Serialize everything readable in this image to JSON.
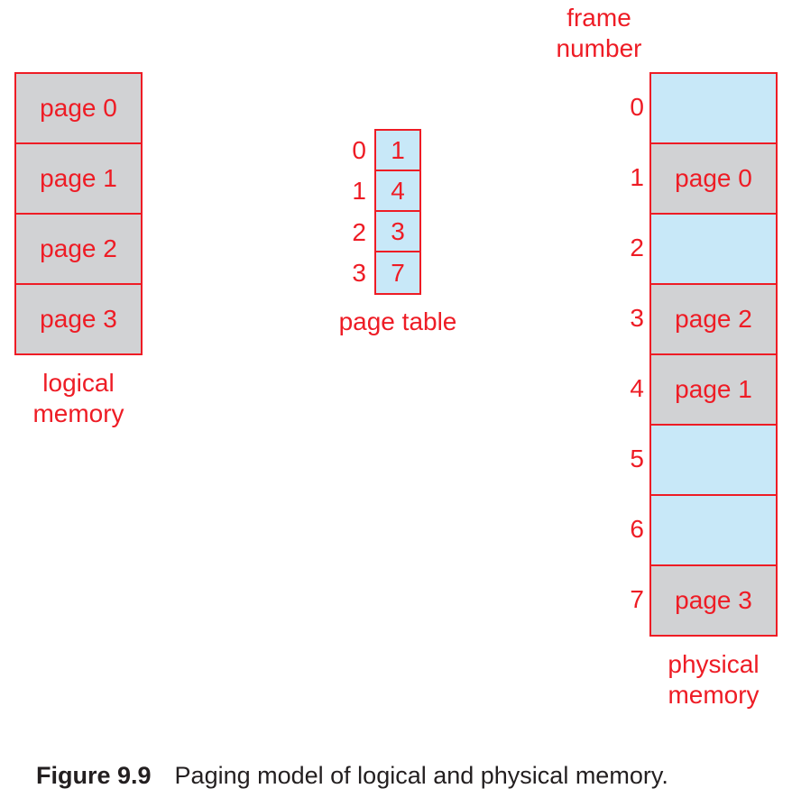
{
  "logical_memory": {
    "label_line1": "logical",
    "label_line2": "memory",
    "pages": [
      "page 0",
      "page 1",
      "page 2",
      "page 3"
    ]
  },
  "page_table": {
    "label": "page table",
    "indices": [
      "0",
      "1",
      "2",
      "3"
    ],
    "frames": [
      "1",
      "4",
      "3",
      "7"
    ]
  },
  "physical_memory": {
    "header_line1": "frame",
    "header_line2": "number",
    "label_line1": "physical",
    "label_line2": "memory",
    "frames": [
      {
        "number": "0",
        "content": "",
        "occupied": false
      },
      {
        "number": "1",
        "content": "page 0",
        "occupied": true
      },
      {
        "number": "2",
        "content": "",
        "occupied": false
      },
      {
        "number": "3",
        "content": "page 2",
        "occupied": true
      },
      {
        "number": "4",
        "content": "page 1",
        "occupied": true
      },
      {
        "number": "5",
        "content": "",
        "occupied": false
      },
      {
        "number": "6",
        "content": "",
        "occupied": false
      },
      {
        "number": "7",
        "content": "page 3",
        "occupied": true
      }
    ]
  },
  "colors": {
    "accent": "#ee1c25",
    "page_fill": "#d1d2d4",
    "free_fill": "#c8e8f8"
  },
  "caption": {
    "figure_label": "Figure 9.9",
    "text": "Paging model of logical and physical memory."
  }
}
